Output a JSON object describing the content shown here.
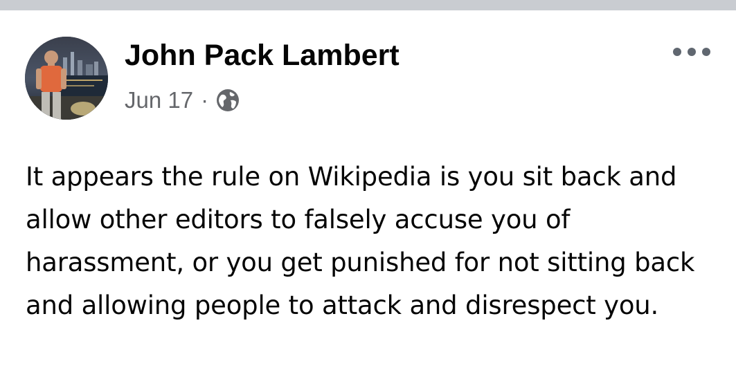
{
  "post": {
    "author": "John Pack Lambert",
    "date": "Jun 17",
    "separator": "·",
    "privacy_icon": "globe-icon",
    "menu_icon": "more-options-icon",
    "text": "It appears the rule on Wikipedia is you sit back and allow other editors to falsely accuse you of harassment, or you get punished for not sitting back and allowing people to attack and disrespect you."
  },
  "colors": {
    "top_strip": "#c9ccd1",
    "name": "#050505",
    "meta": "#65676b",
    "body_text": "#050505"
  }
}
